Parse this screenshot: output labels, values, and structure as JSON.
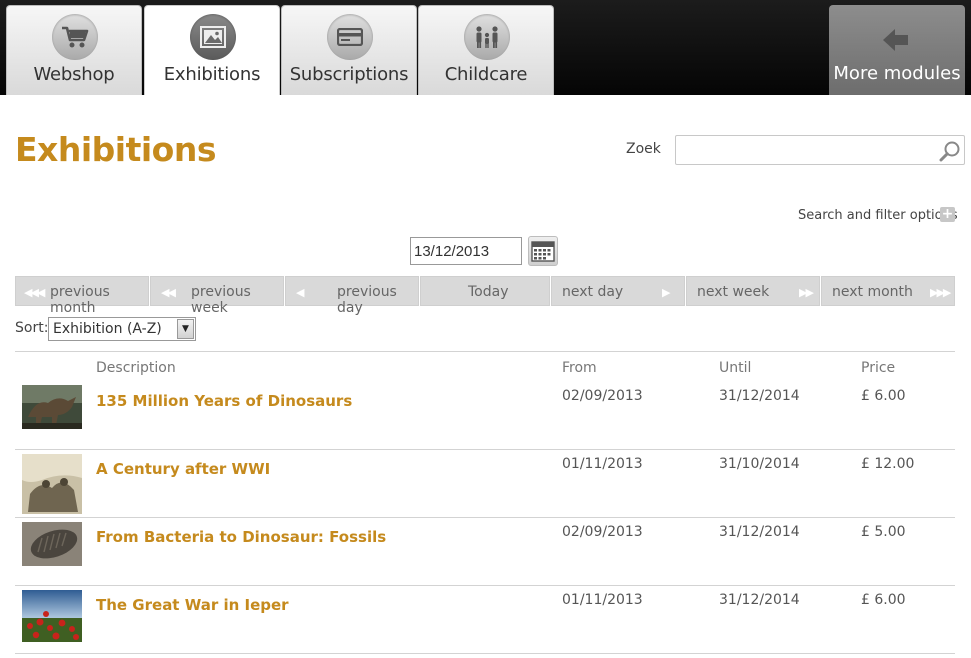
{
  "tabs": [
    {
      "label": "Webshop",
      "icon": "cart-icon"
    },
    {
      "label": "Exhibitions",
      "icon": "picture-icon",
      "active": true
    },
    {
      "label": "Subscriptions",
      "icon": "card-icon"
    },
    {
      "label": "Childcare",
      "icon": "family-icon"
    }
  ],
  "more": {
    "label": "More modules",
    "icon": "arrow-left-icon"
  },
  "page": {
    "title": "Exhibitions"
  },
  "search": {
    "label": "Zoek",
    "value": "",
    "placeholder": ""
  },
  "filter": {
    "label": "Search and filter options"
  },
  "date": {
    "value": "13/12/2013"
  },
  "nav": {
    "prev_month": "previous month",
    "prev_week": "previous week",
    "prev_day": "previous day",
    "today": "Today",
    "next_day": "next day",
    "next_week": "next week",
    "next_month": "next month"
  },
  "sort": {
    "label": "Sort:",
    "value": "Exhibition (A-Z)"
  },
  "table": {
    "headers": {
      "description": "Description",
      "from": "From",
      "until": "Until",
      "price": "Price"
    },
    "rows": [
      {
        "title": "135 Million Years of Dinosaurs",
        "from": "02/09/2013",
        "until": "31/12/2014",
        "price": "£ 6.00"
      },
      {
        "title": "A Century after WWI",
        "from": "01/11/2013",
        "until": "31/10/2014",
        "price": "£ 12.00"
      },
      {
        "title": "From Bacteria to Dinosaur: Fossils",
        "from": "02/09/2013",
        "until": "31/12/2014",
        "price": "£ 5.00"
      },
      {
        "title": "The Great War in Ieper",
        "from": "01/11/2013",
        "until": "31/12/2014",
        "price": "£ 6.00"
      }
    ]
  },
  "colors": {
    "accent": "#c58a1d",
    "topbar": "#111111",
    "nav_button": "#d9d9d9"
  }
}
